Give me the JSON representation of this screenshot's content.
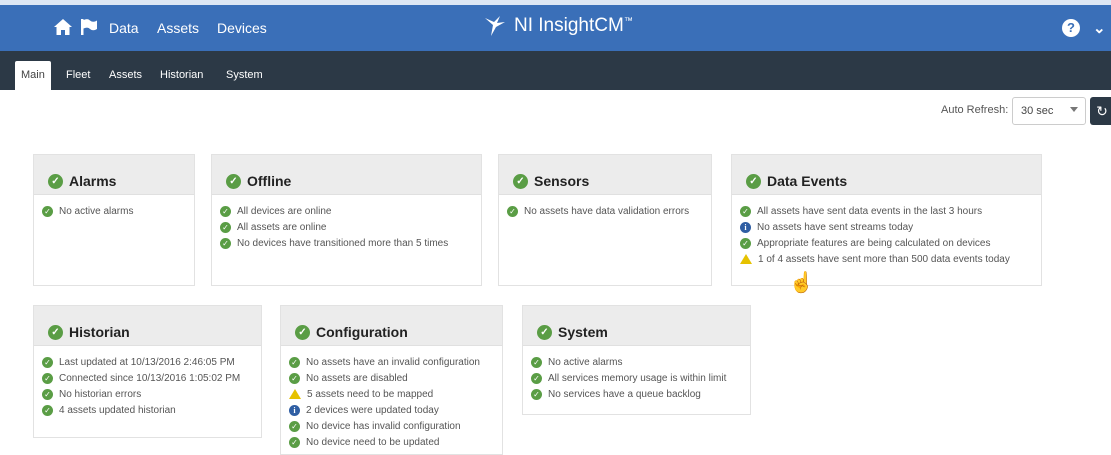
{
  "nav": {
    "data": "Data",
    "assets": "Assets",
    "devices": "Devices",
    "brand": "NI InsightCM",
    "trademark": "™"
  },
  "tabs": [
    "Main",
    "Fleet",
    "Assets",
    "Historian",
    "System"
  ],
  "refresh": {
    "label": "Auto Refresh:",
    "value": "30 sec"
  },
  "cards": {
    "alarms": {
      "title": "Alarms",
      "items": [
        {
          "status": "ok",
          "text": "No active alarms"
        }
      ]
    },
    "offline": {
      "title": "Offline",
      "items": [
        {
          "status": "ok",
          "text": "All devices are online"
        },
        {
          "status": "ok",
          "text": "All assets are online"
        },
        {
          "status": "ok",
          "text": "No devices have transitioned more than 5 times"
        }
      ]
    },
    "sensors": {
      "title": "Sensors",
      "items": [
        {
          "status": "ok",
          "text": "No assets have data validation errors"
        }
      ]
    },
    "data_events": {
      "title": "Data Events",
      "items": [
        {
          "status": "ok",
          "text": "All assets have sent data events in the last 3 hours"
        },
        {
          "status": "info",
          "text": "No assets have sent streams today"
        },
        {
          "status": "ok",
          "text": "Appropriate features are being calculated on devices"
        },
        {
          "status": "warn",
          "text": "1 of 4 assets have sent more than 500 data events today"
        }
      ]
    },
    "historian": {
      "title": "Historian",
      "items": [
        {
          "status": "ok",
          "text": "Last updated at 10/13/2016 2:46:05 PM"
        },
        {
          "status": "ok",
          "text": "Connected since 10/13/2016 1:05:02 PM"
        },
        {
          "status": "ok",
          "text": "No historian errors"
        },
        {
          "status": "ok",
          "text": "4 assets updated historian"
        }
      ]
    },
    "configuration": {
      "title": "Configuration",
      "items": [
        {
          "status": "ok",
          "text": "No assets have an invalid configuration"
        },
        {
          "status": "ok",
          "text": "No assets are disabled"
        },
        {
          "status": "warn",
          "text": "5 assets need to be mapped"
        },
        {
          "status": "info",
          "text": "2 devices were updated today"
        },
        {
          "status": "ok",
          "text": "No device has invalid configuration"
        },
        {
          "status": "ok",
          "text": "No device need to be updated"
        }
      ]
    },
    "system": {
      "title": "System",
      "items": [
        {
          "status": "ok",
          "text": "No active alarms"
        },
        {
          "status": "ok",
          "text": "All services memory usage is within limit"
        },
        {
          "status": "ok",
          "text": "No services have a queue backlog"
        }
      ]
    }
  },
  "colors": {
    "topbar": "#3a6fb8",
    "subbar": "#2c3946",
    "ok": "#5a9d45",
    "info": "#2f5ea3",
    "warn": "#e6c200"
  }
}
